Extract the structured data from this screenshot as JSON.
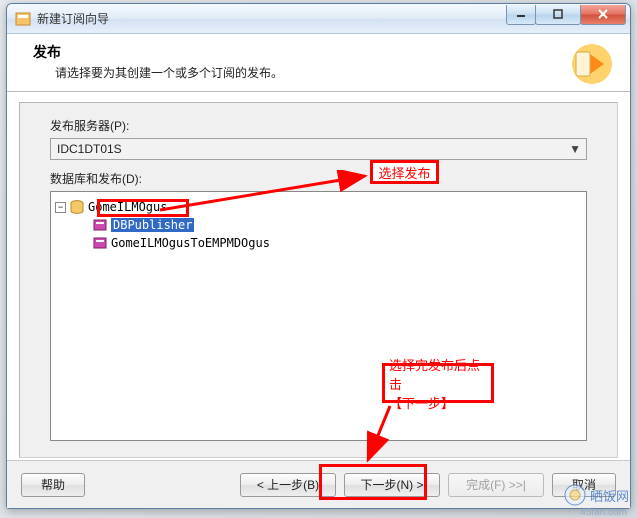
{
  "window": {
    "title": "新建订阅向导"
  },
  "header": {
    "title": "发布",
    "desc": "请选择要为其创建一个或多个订阅的发布。"
  },
  "publisher": {
    "label": "发布服务器(P):",
    "value": "IDC1DT01S"
  },
  "tree": {
    "label": "数据库和发布(D):",
    "root": "GomeILMOgus",
    "items": [
      {
        "name": "DBPublisher",
        "selected": true
      },
      {
        "name": "GomeILMOgusToEMPMDOgus",
        "selected": false
      }
    ]
  },
  "buttons": {
    "help": "帮助",
    "back": "< 上一步(B)",
    "next": "下一步(N) >",
    "finish": "完成(F) >>|",
    "cancel": "取消"
  },
  "annotations": {
    "selectPub": "选择发布",
    "afterSelect_l1": "选择完发布后点击",
    "afterSelect_l2": "【下一步】"
  },
  "watermark": {
    "site": "晒饭网",
    "url": "45fan.com"
  }
}
